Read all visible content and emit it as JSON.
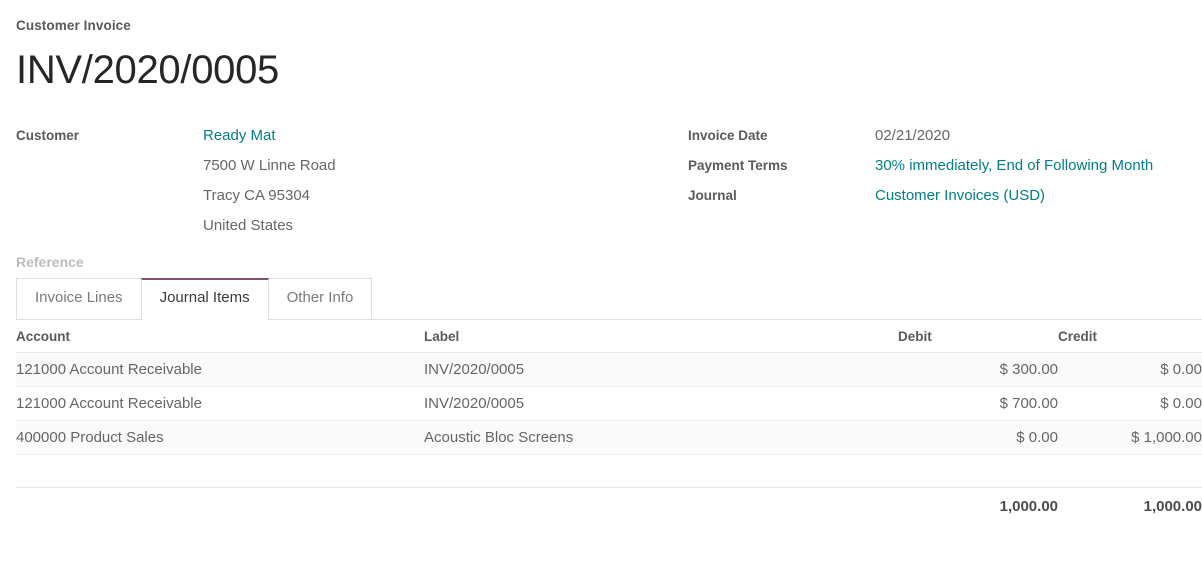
{
  "header": {
    "doc_kind": "Customer Invoice",
    "doc_number": "INV/2020/0005"
  },
  "fields_left": {
    "customer_label": "Customer",
    "customer_name": "Ready Mat",
    "address": [
      "7500 W Linne Road",
      "Tracy CA 95304",
      "United States"
    ],
    "reference_label": "Reference",
    "reference_value": ""
  },
  "fields_right": {
    "invoice_date_label": "Invoice Date",
    "invoice_date_value": "02/21/2020",
    "payment_terms_label": "Payment Terms",
    "payment_terms_value": "30% immediately, End of Following Month",
    "journal_label": "Journal",
    "journal_value": "Customer Invoices (USD)"
  },
  "tabs": [
    {
      "label": "Invoice Lines",
      "active": false
    },
    {
      "label": "Journal Items",
      "active": true
    },
    {
      "label": "Other Info",
      "active": false
    }
  ],
  "table": {
    "columns": [
      "Account",
      "Label",
      "Debit",
      "Credit"
    ],
    "rows": [
      {
        "account": "121000 Account Receivable",
        "label": "INV/2020/0005",
        "debit": "$ 300.00",
        "credit": "$ 0.00"
      },
      {
        "account": "121000 Account Receivable",
        "label": "INV/2020/0005",
        "debit": "$ 700.00",
        "credit": "$ 0.00"
      },
      {
        "account": "400000 Product Sales",
        "label": "Acoustic Bloc Screens",
        "debit": "$ 0.00",
        "credit": "$ 1,000.00"
      }
    ],
    "totals": {
      "account": "",
      "label": "",
      "debit": "1,000.00",
      "credit": "1,000.00"
    }
  },
  "colors": {
    "link_teal": "#017e84",
    "active_tab_accent": "#7d4f72",
    "text_primary": "#262626",
    "text_body": "#666666",
    "label_muted": "#bdbdbd"
  }
}
